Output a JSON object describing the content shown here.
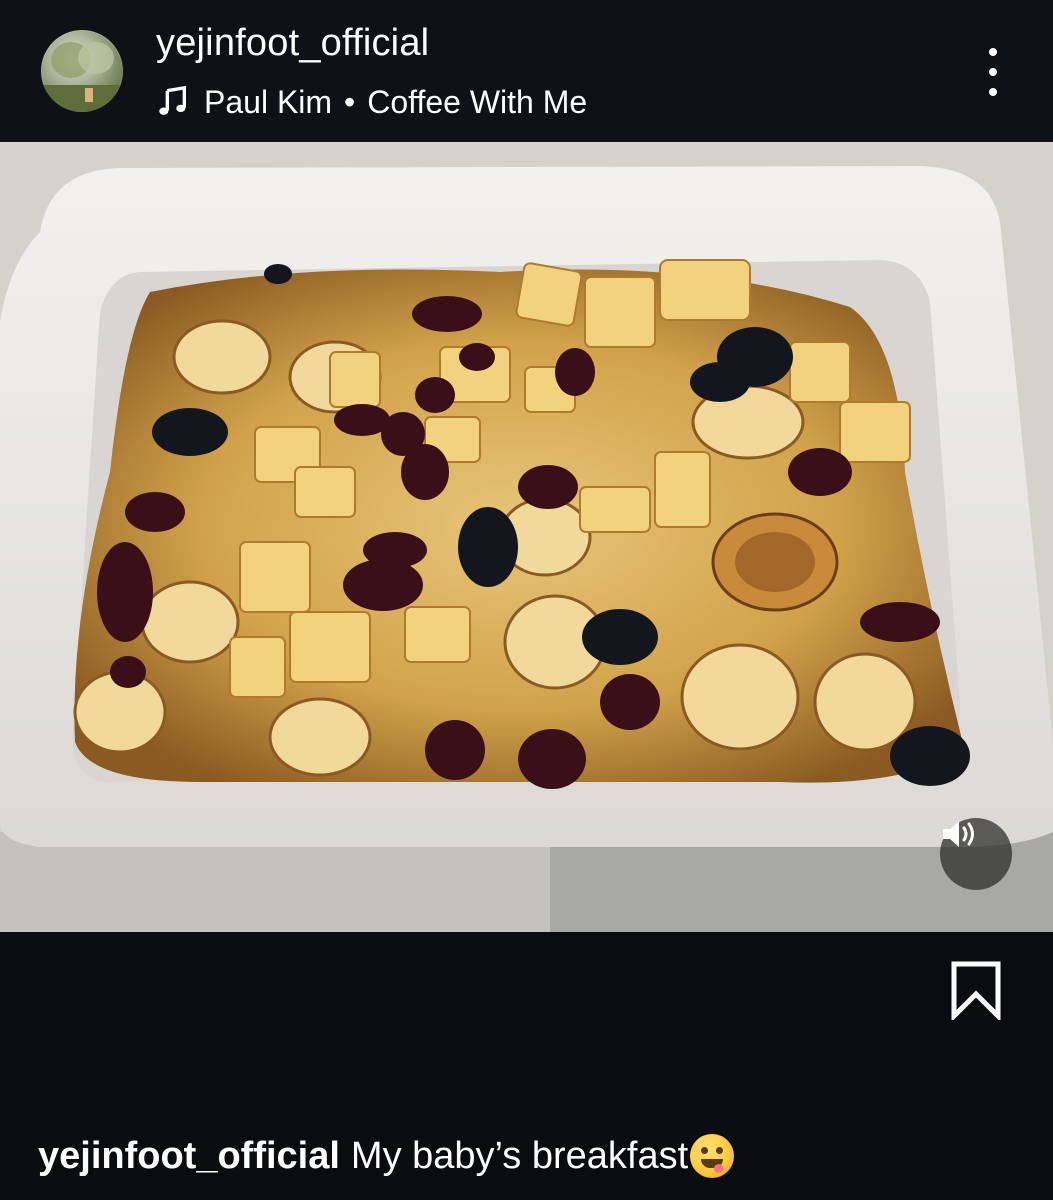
{
  "header": {
    "username": "yejinfoot_official",
    "music": {
      "artist": "Paul Kim",
      "separator": "•",
      "song": "Coffee With Me"
    },
    "more_icon": "more-vertical-icon",
    "avatar_icon": "avatar"
  },
  "post": {
    "media_icon": "food-photo",
    "sound_icon": "speaker-icon",
    "bookmark_icon": "bookmark-icon"
  },
  "caption": {
    "username": "yejinfoot_official",
    "text": "My baby’s breakfast",
    "emoji": "face-savoring-food-emoji"
  },
  "colors": {
    "background": "#0b0c10",
    "text": "#ffffff"
  }
}
